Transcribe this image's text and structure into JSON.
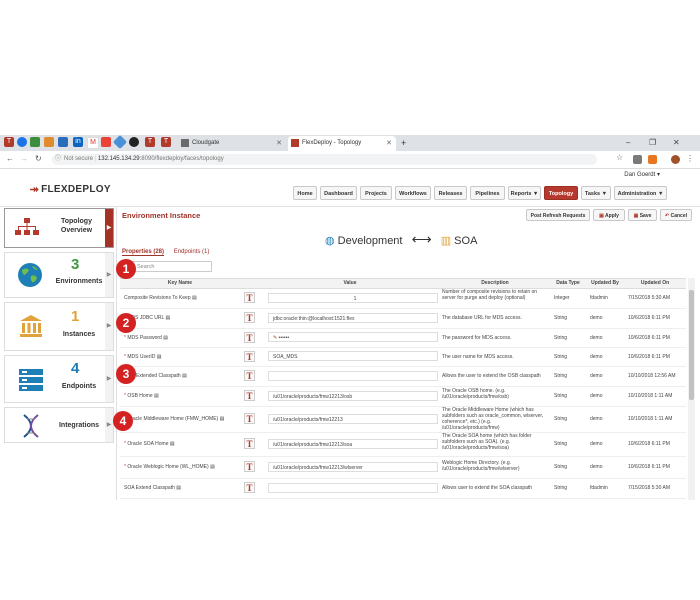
{
  "browser": {
    "tabs": [
      {
        "label": "Cloudgate",
        "active": false
      },
      {
        "label": "FlexDeploy - Topology",
        "active": true
      }
    ],
    "url_prefix": "Not secure",
    "url_domain": "132.145.134.29",
    "url_path": ":8090/flexdeploy/faces/topology",
    "window_controls": [
      "–",
      "❐",
      "✕"
    ]
  },
  "app": {
    "user": "Dan Goerdt",
    "logo": "FLEXDEPLOY",
    "nav": [
      {
        "label": "Home"
      },
      {
        "label": "Dashboard"
      },
      {
        "label": "Projects"
      },
      {
        "label": "Workflows"
      },
      {
        "label": "Releases"
      },
      {
        "label": "Pipelines"
      },
      {
        "label": "Reports ▼"
      },
      {
        "label": "Topology",
        "active": true
      },
      {
        "label": "Tasks ▼"
      },
      {
        "label": "Administration ▼"
      }
    ]
  },
  "left_panel": {
    "topology": "Topology Overview",
    "environments": {
      "count": "3",
      "label": "Environments"
    },
    "instances": {
      "count": "1",
      "label": "Instances"
    },
    "endpoints": {
      "count": "4",
      "label": "Endpoints"
    },
    "integrations": {
      "label": "Integrations"
    }
  },
  "main": {
    "title": "Environment Instance",
    "buttons": {
      "refresh": "Post Refresh Requests",
      "apply": "Apply",
      "save": "Save",
      "cancel": "Cancel"
    },
    "env_from": "Development",
    "env_to": "SOA",
    "tab_properties": "Properties (28)",
    "tab_endpoints": "Endpoints (1)",
    "search_placeholder": "Search",
    "columns": [
      "Key Name",
      "Value",
      "Description",
      "Data Type",
      "Updated By",
      "Updated On"
    ],
    "rows": [
      {
        "key": "Composite Revisions To Keep",
        "req": false,
        "value": "1",
        "desc": "Number of composite revisions to retain on server for purge and deploy (optional)",
        "type": "Integer",
        "by": "fdadmin",
        "on": "7/15/2018 5:30 AM"
      },
      {
        "key": "MDS JDBC URL",
        "req": true,
        "value": "jdbc:oracle:thin:@localhost:1521:flex",
        "desc": "The database URL for MDS access.",
        "type": "String",
        "by": "demo",
        "on": "10/6/2018 6:11 PM"
      },
      {
        "key": "MDS Password",
        "req": true,
        "value": "••••••",
        "desc": "The password for MDS access.",
        "type": "String",
        "by": "demo",
        "on": "10/6/2018 6:11 PM"
      },
      {
        "key": "MDS UserID",
        "req": true,
        "value": "SOA_MDS",
        "desc": "The user name for MDS access.",
        "type": "String",
        "by": "demo",
        "on": "10/6/2018 6:11 PM"
      },
      {
        "key": "OSB Extended Classpath",
        "req": false,
        "value": "",
        "desc": "Allows the user to extend the OSB classpath",
        "type": "String",
        "by": "demo",
        "on": "10/10/2018 12:56 AM"
      },
      {
        "key": "OSB Home",
        "req": true,
        "value": "/u01/oracle/products/fmw12213/osb",
        "desc": "The Oracle OSB home. (e.g. /u01/oracle/products/fmw/osb)",
        "type": "String",
        "by": "demo",
        "on": "10/10/2018 1:11 AM"
      },
      {
        "key": "Oracle Middleware Home (FMW_HOME)",
        "req": true,
        "value": "/u01/oracle/products/fmw12213",
        "desc": "The Oracle Middleware Home (which has subfolders such as oracle_common, wlserver, coherence*, etc.) (e.g. /u01/oracle/products/fmw)",
        "type": "String",
        "by": "demo",
        "on": "10/10/2018 1:11 AM"
      },
      {
        "key": "Oracle SOA Home",
        "req": true,
        "value": "/u01/oracle/products/fmw12213/soa",
        "desc": "The Oracle SOA home (which has folder subfolders such as SOA). (e.g. /u01/oracle/products/fmw/soa)",
        "type": "String",
        "by": "demo",
        "on": "10/6/2018 6:11 PM"
      },
      {
        "key": "Oracle Weblogic Home (WL_HOME)",
        "req": true,
        "value": "/u01/oracle/products/fmw12213/wlserver",
        "desc": "Weblogic Home Directory. (e.g. /u01/oracle/products/fmw/wlserver)",
        "type": "String",
        "by": "demo",
        "on": "10/6/2018 6:11 PM"
      },
      {
        "key": "SOA Extend Classpath",
        "req": false,
        "value": "",
        "desc": "Allows user to extend the SOA classpath",
        "type": "String",
        "by": "fdadmin",
        "on": "7/15/2018 5:30 AM"
      }
    ]
  },
  "badges": [
    "1",
    "2",
    "3",
    "4"
  ]
}
